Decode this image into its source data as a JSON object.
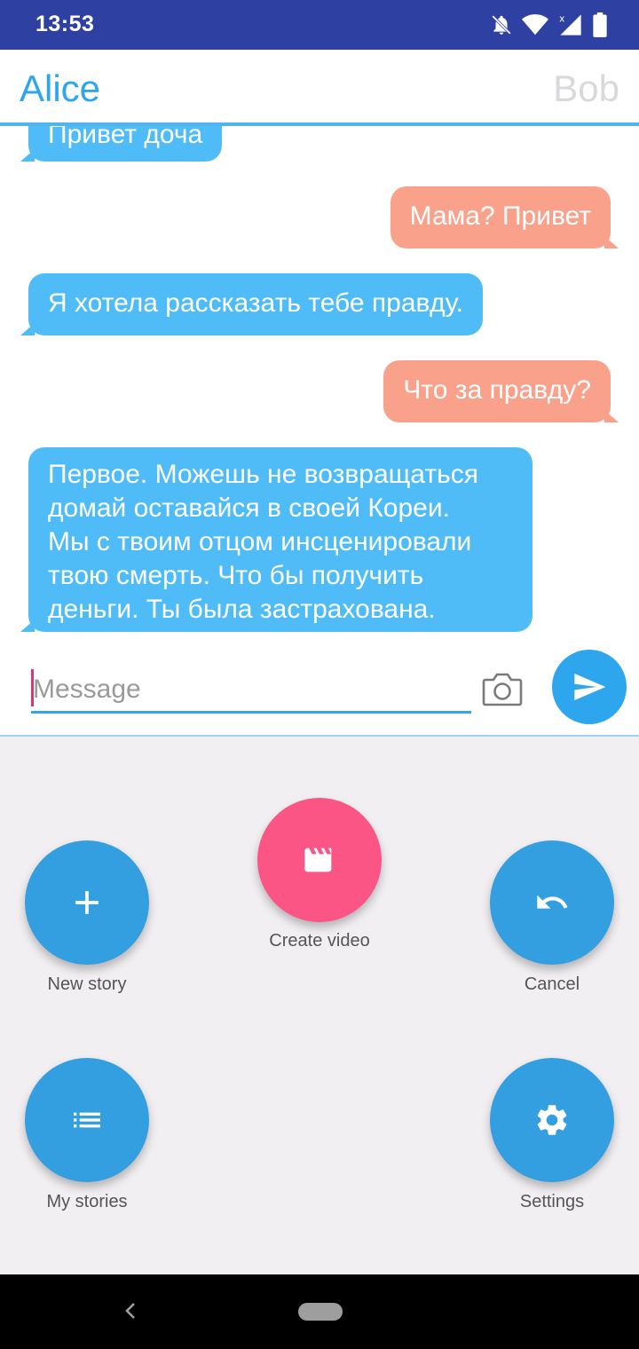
{
  "status_bar": {
    "time": "13:53",
    "icons": [
      "notifications-off-icon",
      "wifi-icon",
      "cell-signal-icon",
      "battery-icon"
    ]
  },
  "header": {
    "left_name": "Alice",
    "right_name": "Bob"
  },
  "messages": [
    {
      "sender": "Alice",
      "side": "left",
      "text": "Привет доча"
    },
    {
      "sender": "Bob",
      "side": "right",
      "text": "Мама? Привет"
    },
    {
      "sender": "Alice",
      "side": "left",
      "text": "Я хотела рассказать тебе правду."
    },
    {
      "sender": "Bob",
      "side": "right",
      "text": "Что за правду?"
    },
    {
      "sender": "Alice",
      "side": "left",
      "lines": [
        "Первое. Можешь не возвращаться",
        "домай оставайся в своей Кореи.",
        "Мы с твоим отцом инсценировали",
        "твою смерть. Что бы получить",
        "деньги. Ты была застрахована."
      ]
    }
  ],
  "composer": {
    "placeholder": "Message",
    "value": "",
    "camera_icon": "camera-icon",
    "send_icon": "send-icon"
  },
  "menu": {
    "create_video": {
      "label": "Create video",
      "icon": "clapperboard-icon"
    },
    "new_story": {
      "label": "New story",
      "icon": "plus-icon"
    },
    "cancel": {
      "label": "Cancel",
      "icon": "undo-icon"
    },
    "my_stories": {
      "label": "My stories",
      "icon": "list-icon"
    },
    "settings": {
      "label": "Settings",
      "icon": "gear-icon"
    }
  },
  "colors": {
    "status_bar": "#2f40a3",
    "accent_blue": "#2ea6ee",
    "bubble_left": "#4fbcf7",
    "bubble_right": "#f9a18a",
    "fab_blue": "#349fe0",
    "fab_pink": "#fb5585",
    "menu_bg": "#f1eff2"
  }
}
